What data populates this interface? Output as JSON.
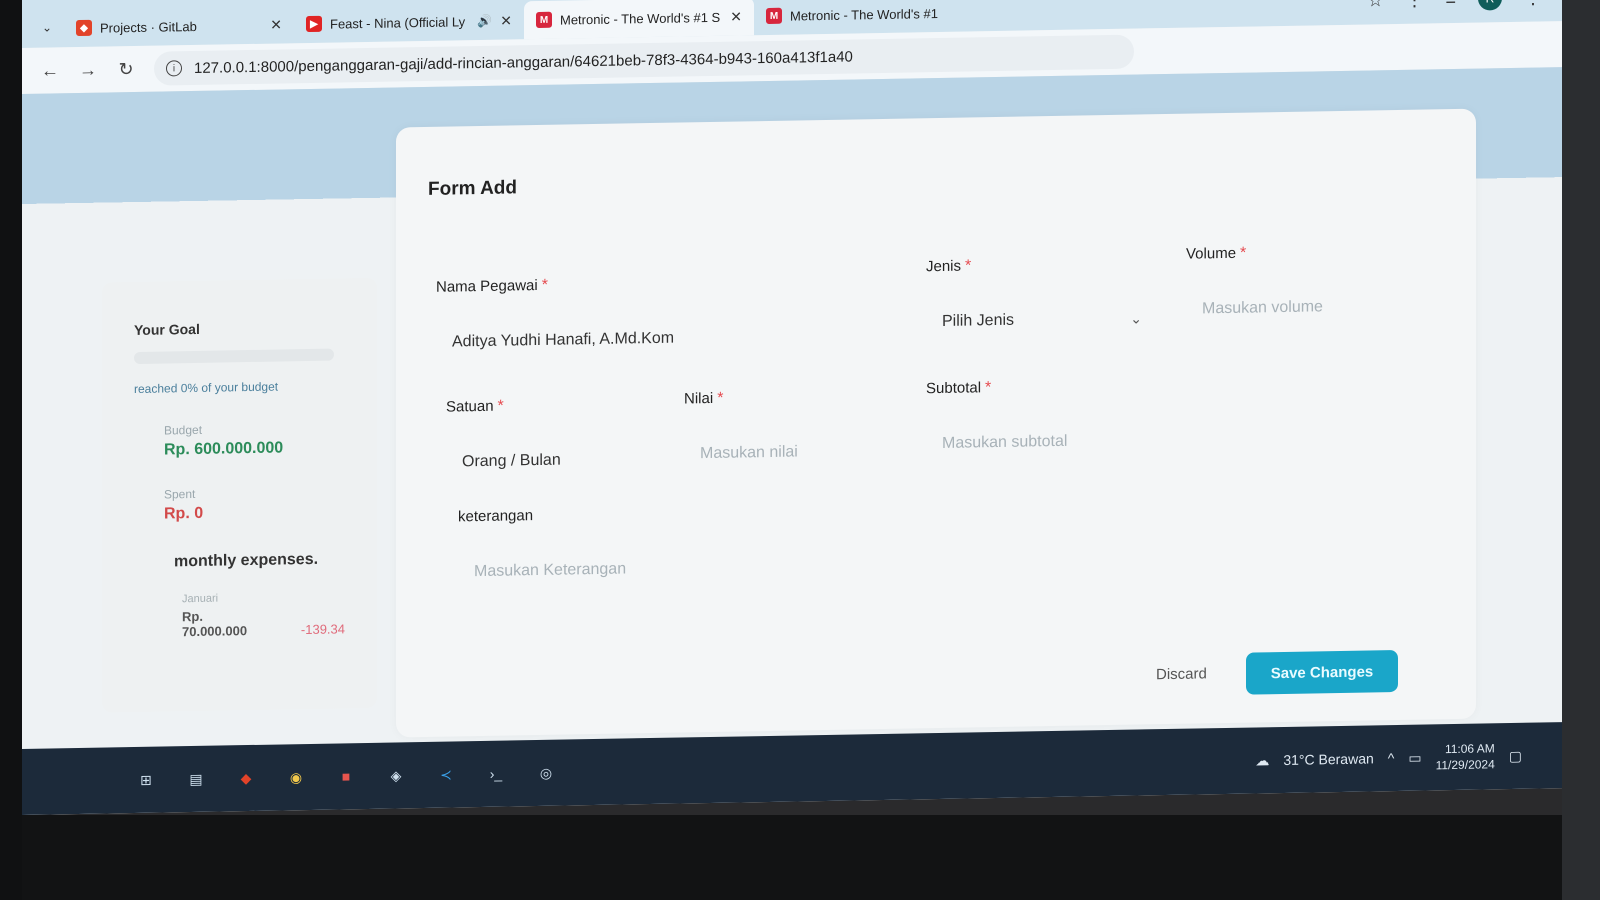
{
  "browser": {
    "tabs": [
      {
        "title": "Projects · GitLab",
        "favicon": "gitlab-icon",
        "color": "#e24329",
        "active": false
      },
      {
        "title": "Feast - Nina (Official Ly",
        "favicon": "youtube-icon",
        "color": "#e02424",
        "active": false,
        "audio": true
      },
      {
        "title": "Metronic - The World's #1 S",
        "favicon": "metronic-icon",
        "color": "#d7263d",
        "active": true
      },
      {
        "title": "Metronic - The World's #1",
        "favicon": "metronic-icon",
        "color": "#d7263d",
        "active": false
      }
    ],
    "url": "127.0.0.1:8000/penganggaran-gaji/add-rincian-anggaran/64621beb-78f3-4364-b943-160a413f1a40",
    "avatar_letter": "R"
  },
  "sidebar": {
    "goal_title": "Your Goal",
    "goal_note": "reached 0% of your budget",
    "goal_progress": 0,
    "budget_label": "Budget",
    "budget_value": "Rp. 600.000.000",
    "spent_label": "Spent",
    "spent_value": "Rp. 0",
    "monthly_title": "monthly expenses.",
    "month_name": "Januari",
    "month_value": "Rp. 70.000.000",
    "month_delta": "-139.34"
  },
  "form": {
    "title": "Form Add",
    "nama_label": "Nama Pegawai",
    "nama_value": "Aditya Yudhi Hanafi, A.Md.Kom",
    "jenis_label": "Jenis",
    "jenis_value": "Pilih Jenis",
    "volume_label": "Volume",
    "volume_placeholder": "Masukan volume",
    "satuan_label": "Satuan",
    "satuan_value": "Orang / Bulan",
    "nilai_label": "Nilai",
    "nilai_placeholder": "Masukan nilai",
    "subtotal_label": "Subtotal",
    "subtotal_placeholder": "Masukan subtotal",
    "keterangan_label": "keterangan",
    "keterangan_placeholder": "Masukan Keterangan",
    "required_mark": "*",
    "discard_label": "Discard",
    "save_label": "Save Changes"
  },
  "taskbar": {
    "weather": "31°C  Berawan",
    "time": "11:06 AM",
    "date": "11/29/2024"
  }
}
